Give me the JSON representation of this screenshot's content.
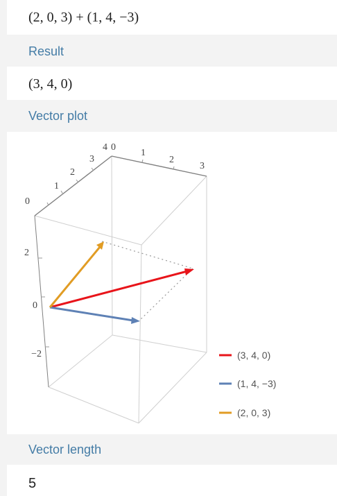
{
  "input": {
    "expression": "(2, 0, 3) + (1, 4, −3)"
  },
  "sections": {
    "result": {
      "header": "Result",
      "value": "(3, 4, 0)"
    },
    "vector_plot": {
      "header": "Vector plot"
    },
    "vector_length": {
      "header": "Vector length",
      "value": "5"
    }
  },
  "plot": {
    "top_axis_ticks": [
      "0",
      "1",
      "2",
      "3"
    ],
    "left_depth_ticks": [
      "0",
      "1",
      "2",
      "3",
      "4"
    ],
    "vertical_ticks": [
      "2",
      "0",
      "−2"
    ],
    "legend": [
      {
        "label": "(3, 4, 0)",
        "color": "#e8141a"
      },
      {
        "label": "(1, 4, −3)",
        "color": "#5e81b5"
      },
      {
        "label": "(2, 0, 3)",
        "color": "#e19c24"
      }
    ]
  }
}
